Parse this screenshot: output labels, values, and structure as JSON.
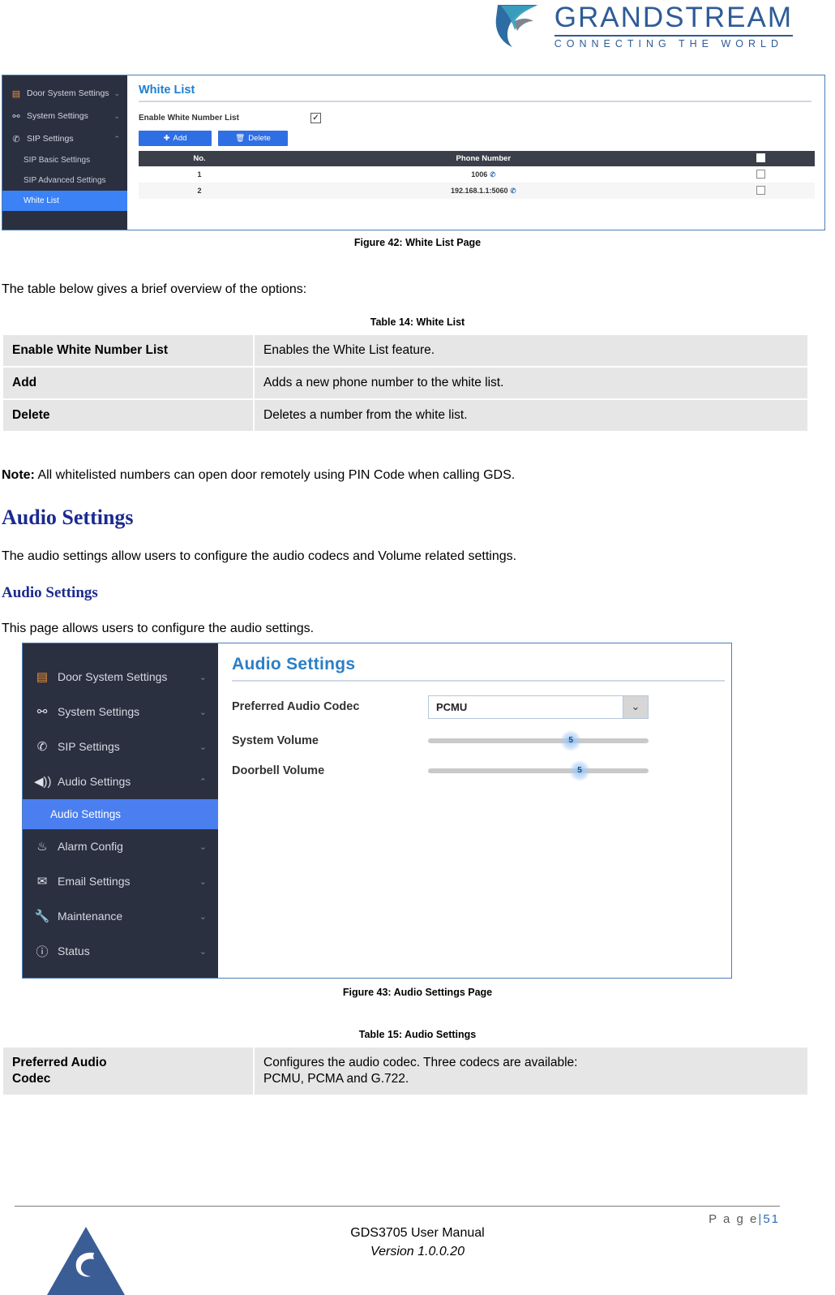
{
  "brand": {
    "name": "GRANDSTREAM",
    "tagline": "CONNECTING THE WORLD",
    "logo_icon": "grandstream-swoosh-logo",
    "color": "#2e5c97"
  },
  "figure42": {
    "caption": "Figure 42: White List Page",
    "sidebar": {
      "items": [
        {
          "label": "Door System Settings",
          "icon": "door-icon",
          "caret": "chevron-down-icon"
        },
        {
          "label": "System Settings",
          "icon": "gear-node-icon",
          "caret": "chevron-down-icon"
        },
        {
          "label": "SIP Settings",
          "icon": "phone-icon",
          "caret": "chevron-up-icon"
        }
      ],
      "sub_items": [
        {
          "label": "SIP Basic Settings",
          "active": false
        },
        {
          "label": "SIP Advanced Settings",
          "active": false
        },
        {
          "label": "White List",
          "active": true
        }
      ]
    },
    "panel": {
      "title": "White List",
      "enable_label": "Enable White Number List",
      "enable_checked": true,
      "check_glyph": "✓",
      "add_label": "Add",
      "add_icon": "plus-icon",
      "delete_label": "Delete",
      "delete_icon": "trash-icon",
      "accent_color": "#2f6fe4",
      "table": {
        "headers": [
          "No.",
          "Phone Number",
          ""
        ],
        "rows": [
          {
            "no": "1",
            "number": "1006",
            "number_icon": "phone-icon",
            "checked": false
          },
          {
            "no": "2",
            "number": "192.168.1.1:5060",
            "number_icon": "phone-icon",
            "checked": false
          }
        ]
      }
    }
  },
  "body": {
    "intro": "The table below gives a brief overview of the options:",
    "note_label": "Note:",
    "note_text": "All whitelisted numbers can open door remotely using PIN Code when calling GDS.",
    "audio_heading_1": "Audio Settings",
    "audio_para_1": "The audio settings allow users to configure the audio codecs and Volume related settings.",
    "audio_heading_2": "Audio Settings",
    "audio_para_2": "This page allows users to configure the audio settings."
  },
  "table14": {
    "caption": "Table 14: White List",
    "rows": [
      {
        "key": "Enable White Number List",
        "value": "Enables the White List feature."
      },
      {
        "key": "Add",
        "value": "Adds a new phone number to the white list."
      },
      {
        "key": "Delete",
        "value": "Deletes a number from the white list."
      }
    ]
  },
  "figure43": {
    "caption": "Figure 43: Audio Settings Page",
    "sidebar": {
      "items": [
        {
          "label": "Door System Settings",
          "icon": "door-icon",
          "caret": "chevron-down-icon"
        },
        {
          "label": "System Settings",
          "icon": "gear-node-icon",
          "caret": "chevron-down-icon"
        },
        {
          "label": "SIP Settings",
          "icon": "phone-icon",
          "caret": "chevron-down-icon"
        },
        {
          "label": "Audio Settings",
          "icon": "speaker-icon",
          "caret": "chevron-up-icon"
        }
      ],
      "sub_item": {
        "label": "Audio Settings",
        "active": true
      },
      "items_after": [
        {
          "label": "Alarm Config",
          "icon": "bell-icon",
          "caret": "chevron-down-icon"
        },
        {
          "label": "Email Settings",
          "icon": "envelope-icon",
          "caret": "chevron-down-icon"
        },
        {
          "label": "Maintenance",
          "icon": "wrench-icon",
          "caret": "chevron-down-icon"
        },
        {
          "label": "Status",
          "icon": "info-icon",
          "caret": "chevron-down-icon"
        }
      ]
    },
    "panel": {
      "title": "Audio Settings",
      "codec_label": "Preferred Audio Codec",
      "codec_value": "PCMU",
      "codec_caret": "chevron-down-icon",
      "system_volume_label": "System Volume",
      "system_volume_value": "5",
      "doorbell_volume_label": "Doorbell Volume",
      "doorbell_volume_value": "5"
    }
  },
  "table15": {
    "caption": "Table 15: Audio Settings",
    "rows": [
      {
        "key": "Preferred Audio Codec",
        "value": "Configures the audio codec. Three codecs are available:\nPCMU, PCMA and G.722."
      }
    ]
  },
  "footer": {
    "page_word": "P a g e",
    "page_bar": "|",
    "page_number": "51",
    "manual": "GDS3705 User Manual",
    "version": "Version 1.0.0.20",
    "logo_icon": "grandstream-triangle-logo"
  }
}
